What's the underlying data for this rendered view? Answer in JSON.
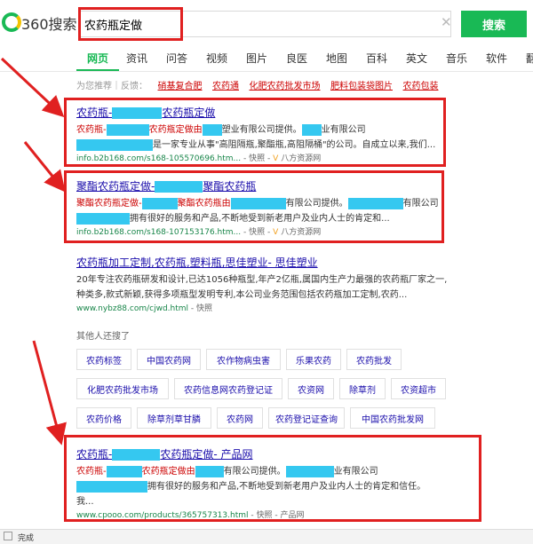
{
  "header": {
    "logo_text": "360搜索",
    "query": "农药瓶定做",
    "clear_icon": "close-icon",
    "search_button": "搜索"
  },
  "tabs": [
    "网页",
    "资讯",
    "问答",
    "视频",
    "图片",
    "良医",
    "地图",
    "百科",
    "英文",
    "音乐",
    "软件",
    "翻"
  ],
  "recommend": {
    "label": "为您推荐｜反馈：",
    "links": [
      "硝基复合肥",
      "农药通",
      "化肥农药批发市场",
      "肥料包装袋图片",
      "农药包装"
    ]
  },
  "results": [
    {
      "title_a": "农药瓶-",
      "title_b": "农药瓶定做",
      "line1_a": "农药瓶-",
      "line1_b": "农药瓶定做由",
      "line1_c": "塑业有限公司提供。",
      "line1_d": "业有限公司",
      "line2_b": "是一家专业从事\"高阻隔瓶,聚酯瓶,高阻隔桶\"的公司。自成立以来,我们...",
      "url": "info.b2b168.com/s168-105570696.htm...",
      "snapshot": "快照",
      "source": "八方资源网"
    },
    {
      "title_a": "聚酯农药瓶定做-",
      "title_b": "聚酯农药瓶",
      "line1_a": "聚酯农药瓶定做-",
      "line1_b": "聚酯农药瓶由",
      "line1_c": "有限公司提供。",
      "line1_d": "有限公司",
      "line2_b": "拥有很好的服务和产品,不断地受到新老用户及业内人士的肯定和...",
      "url": "info.b2b168.com/s168-107153176.htm...",
      "snapshot": "快照",
      "source": "八方资源网"
    },
    {
      "title": "农药瓶加工定制,农药瓶,塑料瓶,思佳塑业- 思佳塑业",
      "line1": "20年专注农药瓶研发和设计,已达1056种瓶型,年产2亿瓶,属国内生产力最强的农药瓶厂家之一,",
      "line2": "种类多,款式新颖,获得多项瓶型发明专利,本公司业务范围包括农药瓶加工定制,农药...",
      "url": "www.nybz88.com/cjwd.html",
      "snapshot": "快照"
    },
    {
      "title_a": "农药瓶-",
      "title_b": "农药瓶定做- 产品网",
      "line1_a": "农药瓶-",
      "line1_b": "农药瓶定做由",
      "line1_c": "有限公司提供。",
      "line1_d": "业有限公司",
      "line2_b": "拥有很好的服务和产品,不断地受到新老用户及业内人士的肯定和信任。",
      "line3": "我...",
      "url": "www.cpooo.com/products/365757313.html",
      "snapshot": "快照",
      "source": "产品网"
    }
  ],
  "others": {
    "title": "其他人还搜了",
    "rows": [
      [
        "农药标签",
        "中国农药网",
        "农作物病虫害",
        "乐果农药",
        "农药批发"
      ],
      [
        "化肥农药批发市场",
        "农药信息网农药登记证",
        "农资网",
        "除草剂",
        "农资超市"
      ],
      [
        "农药价格",
        "除草剂草甘膦",
        "农药网",
        "农药登记证查询",
        "中国农药批发网"
      ]
    ]
  },
  "status": {
    "text": "完成"
  },
  "colors": {
    "brand_green": "#19b955",
    "annotation_red": "#e02020",
    "link_blue": "#1a0dab",
    "redact_cyan": "#35c8f0"
  }
}
